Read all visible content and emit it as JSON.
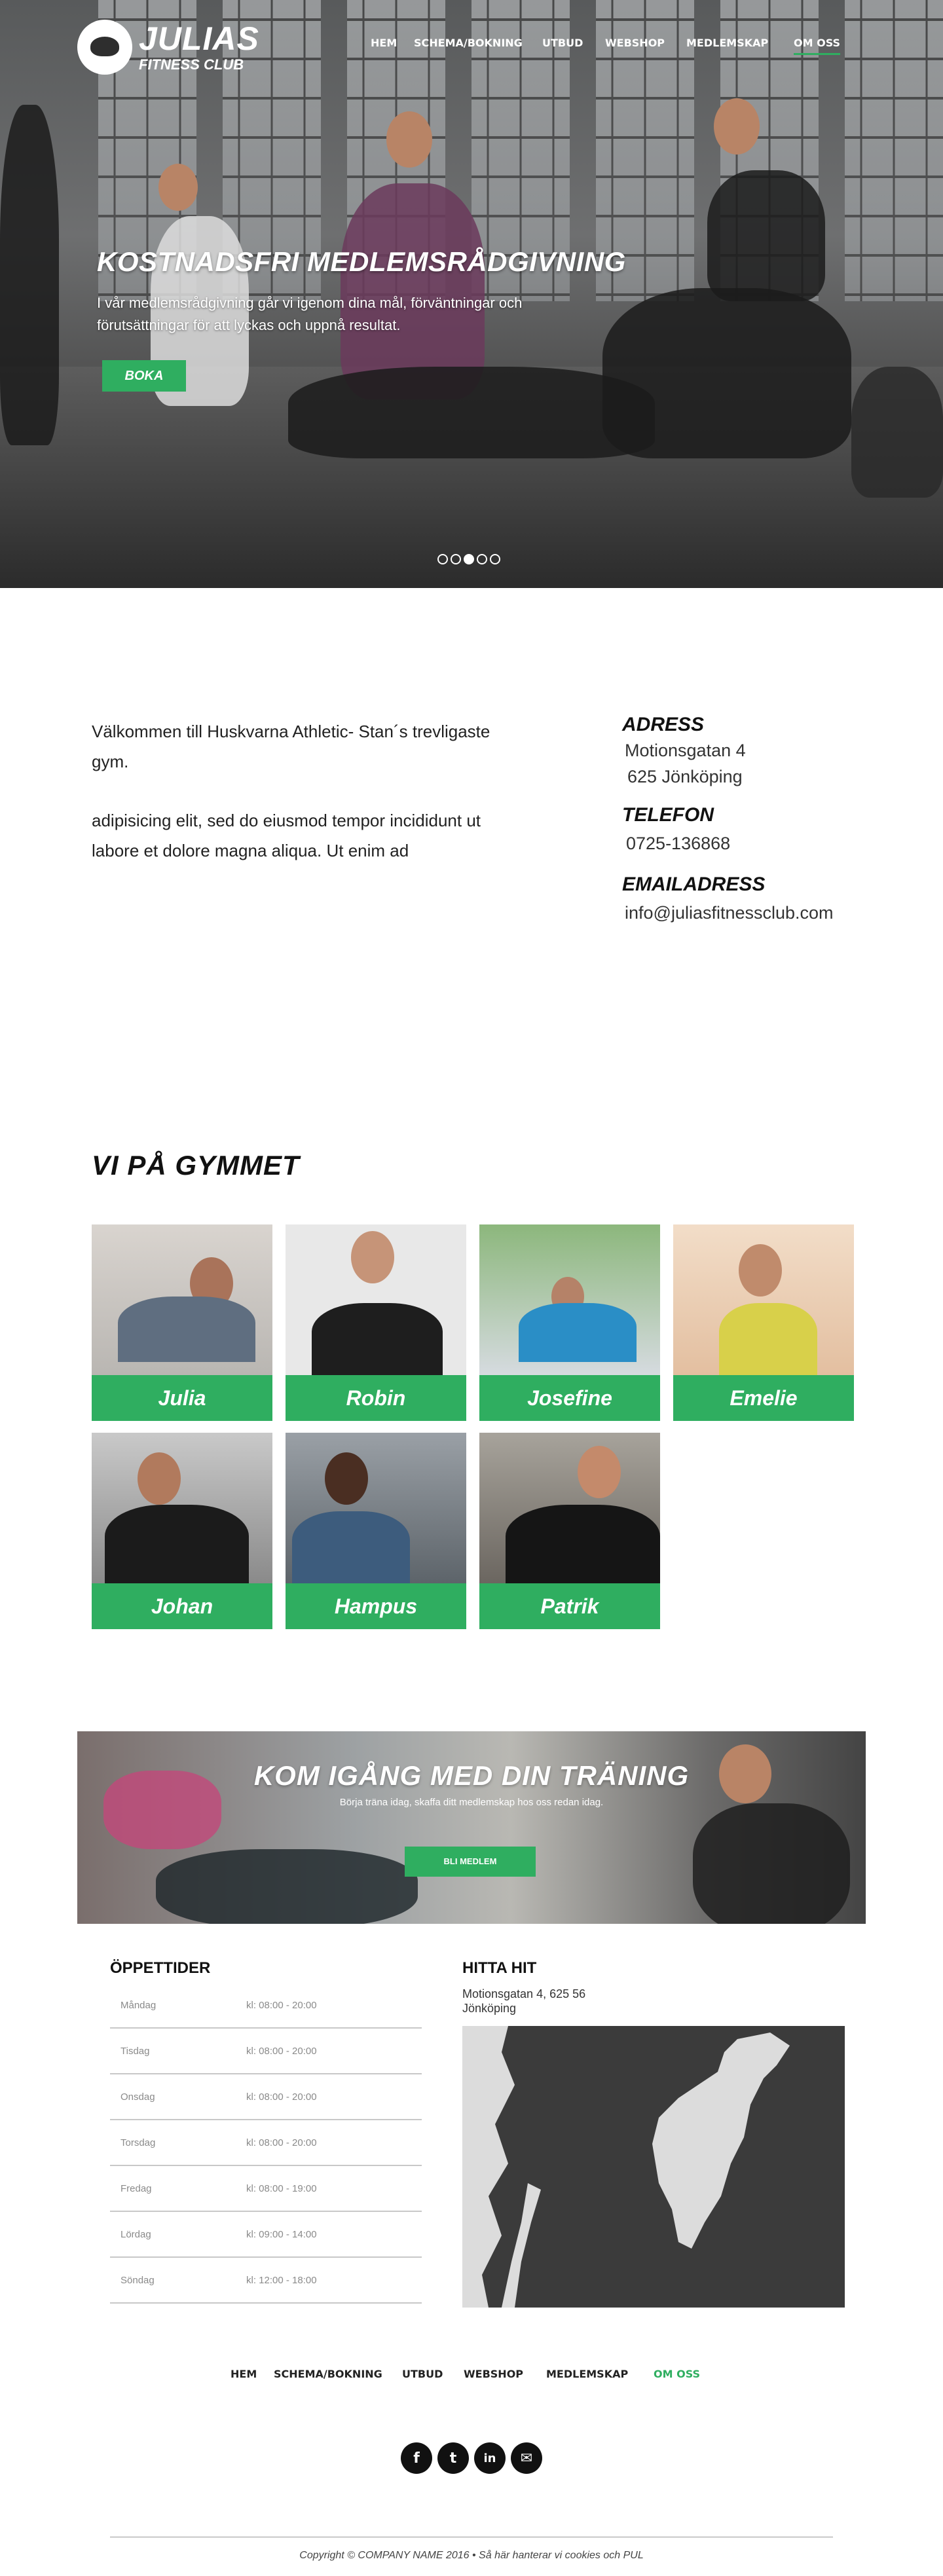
{
  "brand": {
    "title": "JULIAS",
    "subtitle": "FITNESS CLUB"
  },
  "nav": {
    "items": [
      {
        "label": "HEM"
      },
      {
        "label": "SCHEMA/BOKNING"
      },
      {
        "label": "UTBUD"
      },
      {
        "label": "WEBSHOP"
      },
      {
        "label": "MEDLEMSKAP"
      },
      {
        "label": "OM OSS"
      }
    ],
    "active": "OM OSS"
  },
  "hero": {
    "title": "KOSTNADSFRI MEDLEMSRÅDGIVNING",
    "text": " I vår medlemsrådgivning går vi igenom dina mål, förväntningar och förutsättningar för att lyckas och uppnå resultat.",
    "button": "BOKA",
    "slides": 5,
    "active_slide": 3
  },
  "intro": {
    "p1": "Välkommen till Huskvarna Athletic- Stan´s trevligaste gym.",
    "p2": "adipisicing elit, sed do eiusmod tempor incididunt ut labore et dolore magna aliqua. Ut enim ad"
  },
  "contact": {
    "address_heading": "ADRESS",
    "address_line1": "Motionsgatan 4",
    "address_line2": "625 Jönköping",
    "phone_heading": "TELEFON",
    "phone": "0725-136868",
    "email_heading": "EMAILADRESS",
    "email": "info@juliasfitnessclub.com"
  },
  "team": {
    "title": "VI PÅ GYMMET",
    "members": [
      "Julia",
      "Robin",
      "Josefine",
      "Emelie",
      "Johan",
      "Hampus",
      "Patrik"
    ]
  },
  "cta": {
    "title": "KOM IGÅNG MED DIN TRÄNING",
    "subtitle": "Börja träna idag, skaffa ditt medlemskap hos oss redan idag.",
    "button": "BLI MEDLEM"
  },
  "hours": {
    "title": "ÖPPETTIDER",
    "rows": [
      {
        "day": "Måndag",
        "time": "kl: 08:00 - 20:00"
      },
      {
        "day": "Tisdag",
        "time": "kl: 08:00 - 20:00"
      },
      {
        "day": "Onsdag",
        "time": "kl: 08:00 - 20:00"
      },
      {
        "day": "Torsdag",
        "time": "kl: 08:00 - 20:00"
      },
      {
        "day": "Fredag",
        "time": "kl: 08:00 - 19:00"
      },
      {
        "day": "Lördag",
        "time": "kl: 09:00 - 14:00"
      },
      {
        "day": "Söndag",
        "time": "kl: 12:00 - 18:00"
      }
    ]
  },
  "find": {
    "title": "HITTA HIT",
    "address": "Motionsgatan 4, 625 56 Jönköping"
  },
  "footer": {
    "nav": [
      "HEM",
      "SCHEMA/BOKNING",
      "UTBUD",
      "WEBSHOP",
      "MEDLEMSKAP",
      "OM OSS"
    ],
    "social": [
      "facebook-icon",
      "twitter-icon",
      "linkedin-icon",
      "email-icon"
    ],
    "copyright": "Copyright © COMPANY NAME 2016 • Så här hanterar vi cookies och PUL"
  },
  "colors": {
    "accent": "#2fae60",
    "dark": "#111111",
    "map": "#3b3b3b"
  }
}
